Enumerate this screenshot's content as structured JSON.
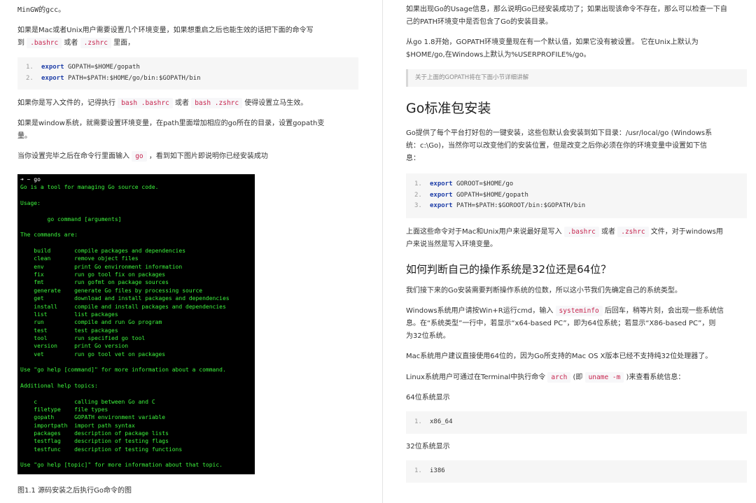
{
  "left": {
    "p1": "MinGW的gcc。",
    "p2_line1": "如果是Mac或者Unix用户需要设置几个环境变量，如果想重启之后也能生效的话把下面的命令写",
    "p2_line2_pre": "到",
    "p2_code1": ".bashrc",
    "p2_mid": "或者",
    "p2_code2": ".zshrc",
    "p2_post": "里面，",
    "code1": [
      {
        "num": "1.",
        "kw": "export",
        "rest": "GOPATH=$HOME/gopath"
      },
      {
        "num": "2.",
        "kw": "export",
        "rest": "PATH=$PATH:$HOME/go/bin:$GOPATH/bin"
      }
    ],
    "p3_pre": "如果你是写入文件的，记得执行",
    "p3_code1": "bash .bashrc",
    "p3_mid": "或者",
    "p3_code2": "bash .zshrc",
    "p3_post": "使得设置立马生效。",
    "p4_line1": "如果是window系统，就需要设置环境变量，在path里面增加相应的go所在的目录，设置gopath变",
    "p4_line2": "量。",
    "p5_pre": "当你设置完毕之后在命令行里面输入",
    "p5_code": "go",
    "p5_post": "，看到如下图片即说明你已经安装成功",
    "terminal_prompt": "➜ ~ go",
    "terminal_body": "Go is a tool for managing Go source code.\n\nUsage:\n\n        go command [arguments]\n\nThe commands are:\n\n    build       compile packages and dependencies\n    clean       remove object files\n    env         print Go environment information\n    fix         run go tool fix on packages\n    fmt         run gofmt on package sources\n    generate    generate Go files by processing source\n    get         download and install packages and dependencies\n    install     compile and install packages and dependencies\n    list        list packages\n    run         compile and run Go program\n    test        test packages\n    tool        run specified go tool\n    version     print Go version\n    vet         run go tool vet on packages\n\nUse \"go help [command]\" for more information about a command.\n\nAdditional help topics:\n\n    c           calling between Go and C\n    filetype    file types\n    gopath      GOPATH environment variable\n    importpath  import path syntax\n    packages    description of package lists\n    testflag    description of testing flags\n    testfunc    description of testing functions\n\nUse \"go help [topic]\" for more information about that topic.",
    "caption": "图1.1 源码安装之后执行Go命令的图"
  },
  "right": {
    "p1_line1": "如果出现Go的Usage信息，那么说明Go已经安装成功了；如果出现该命令不存在，那么可以检查一下自",
    "p1_line2": "己的PATH环境变中是否包含了Go的安装目录。",
    "p2_line1": "从go 1.8开始，GOPATH环境变量现在有一个默认值，如果它没有被设置。 它在Unix上默认为",
    "p2_line2": "$HOME/go,在Windows上默认为%USERPROFILE%/go。",
    "quote": "关于上面的GOPATH将在下面小节详细讲解",
    "h_install": "Go标准包安装",
    "p3_line1": "Go提供了每个平台打好包的一键安装，这些包默认会安装到如下目录：/usr/local/go (Windows系",
    "p3_line2": "统：c:\\Go)，当然你可以改变他们的安装位置，但是改变之后你必须在你的环境变量中设置如下信",
    "p3_line3": "息：",
    "code2": [
      {
        "num": "1.",
        "kw": "export",
        "rest": "GOROOT=$HOME/go"
      },
      {
        "num": "2.",
        "kw": "export",
        "rest": "GOPATH=$HOME/gopath"
      },
      {
        "num": "3.",
        "kw": "export",
        "rest": "PATH=$PATH:$GOROOT/bin:$GOPATH/bin"
      }
    ],
    "p4_pre": "上面这些命令对于Mac和Unix用户来说最好是写入",
    "p4_code1": ".bashrc",
    "p4_mid": "或者",
    "p4_code2": ".zshrc",
    "p4_post": "文件，对于windows用",
    "p4_line2": "户来说当然是写入环境变量。",
    "h_arch": "如何判断自己的操作系统是32位还是64位？",
    "p5": "我们接下来的Go安装需要判断操作系统的位数，所以这小节我们先确定自己的系统类型。",
    "p6_pre": "Windows系统用户请按Win+R运行cmd，输入",
    "p6_code": "systeminfo",
    "p6_post": "后回车，稍等片刻，会出现一些系统信",
    "p6_line2": "息。在“系统类型”一行中，若显示“x64-based PC”，即为64位系统；若显示“X86-based PC”，则",
    "p6_line3": "为32位系统。",
    "p7": "Mac系统用户建议直接使用64位的，因为Go所支持的Mac OS X版本已经不支持纯32位处理器了。",
    "p8_pre": "Linux系统用户可通过在Terminal中执行命令",
    "p8_code1": "arch",
    "p8_mid": "(即",
    "p8_code2": "uname -m",
    "p8_post": ")来查看系统信息：",
    "label64": "64位系统显示",
    "code3": {
      "num": "1.",
      "text": "x86_64"
    },
    "label32": "32位系统显示",
    "code4": {
      "num": "1.",
      "text": "i386"
    }
  }
}
